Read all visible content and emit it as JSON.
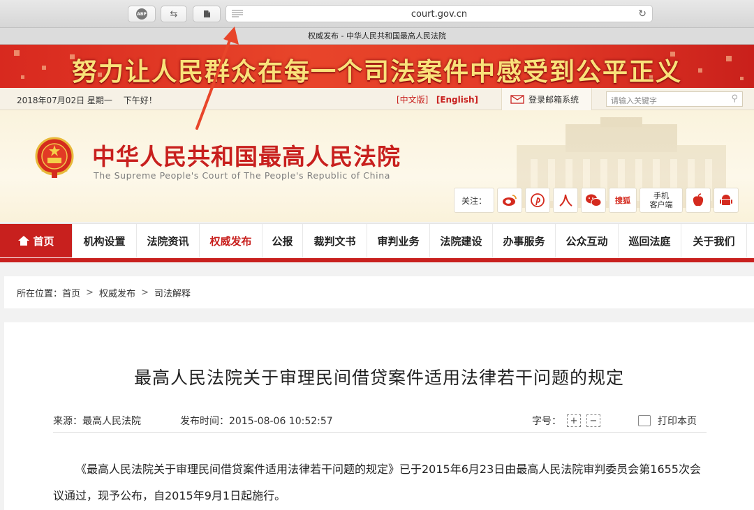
{
  "browser": {
    "url": "court.gov.cn",
    "tab_title": "权威发布 - 中华人民共和国最高人民法院",
    "abp_label": "ABP"
  },
  "banner": {
    "slogan": "努力让人民群众在每一个司法案件中感受到公平正义"
  },
  "infobar": {
    "date": "2018年07月02日 星期一　 下午好！",
    "lang_cn": "[中文版]",
    "lang_en": "[English]",
    "mail_label": "登录邮箱系统",
    "search_placeholder": "请输入关键字"
  },
  "header": {
    "court_name_cn": "中华人民共和国最高人民法院",
    "court_name_en": "The Supreme People's Court of The People's Republic of China",
    "follow_label": "关注：",
    "sohu_label": "搜狐",
    "mobile_label_1": "手机",
    "mobile_label_2": "客户端"
  },
  "nav": {
    "items": [
      {
        "label": "首页"
      },
      {
        "label": "机构设置"
      },
      {
        "label": "法院资讯"
      },
      {
        "label": "权威发布"
      },
      {
        "label": "公报"
      },
      {
        "label": "裁判文书"
      },
      {
        "label": "审判业务"
      },
      {
        "label": "法院建设"
      },
      {
        "label": "办事服务"
      },
      {
        "label": "公众互动"
      },
      {
        "label": "巡回法庭"
      },
      {
        "label": "关于我们"
      }
    ]
  },
  "breadcrumb": {
    "prefix": "所在位置：",
    "items": [
      "首页",
      "权威发布",
      "司法解释"
    ],
    "sep": ">"
  },
  "article": {
    "title": "最高人民法院关于审理民间借贷案件适用法律若干问题的规定",
    "source": "来源：最高人民法院",
    "published": "发布时间：2015-08-06 10:52:57",
    "font_size_label": "字号：",
    "font_plus": "+",
    "font_minus": "−",
    "print_label": "打印本页",
    "body": "《最高人民法院关于审理民间借贷案件适用法律若干问题的规定》已于2015年6月23日由最高人民法院审判委员会第1655次会议通过，现予公布，自2015年9月1日起施行。"
  },
  "colors": {
    "brand_red": "#c8201e",
    "slogan_gold": "#f9e27a",
    "arrow": "#e8452a"
  }
}
